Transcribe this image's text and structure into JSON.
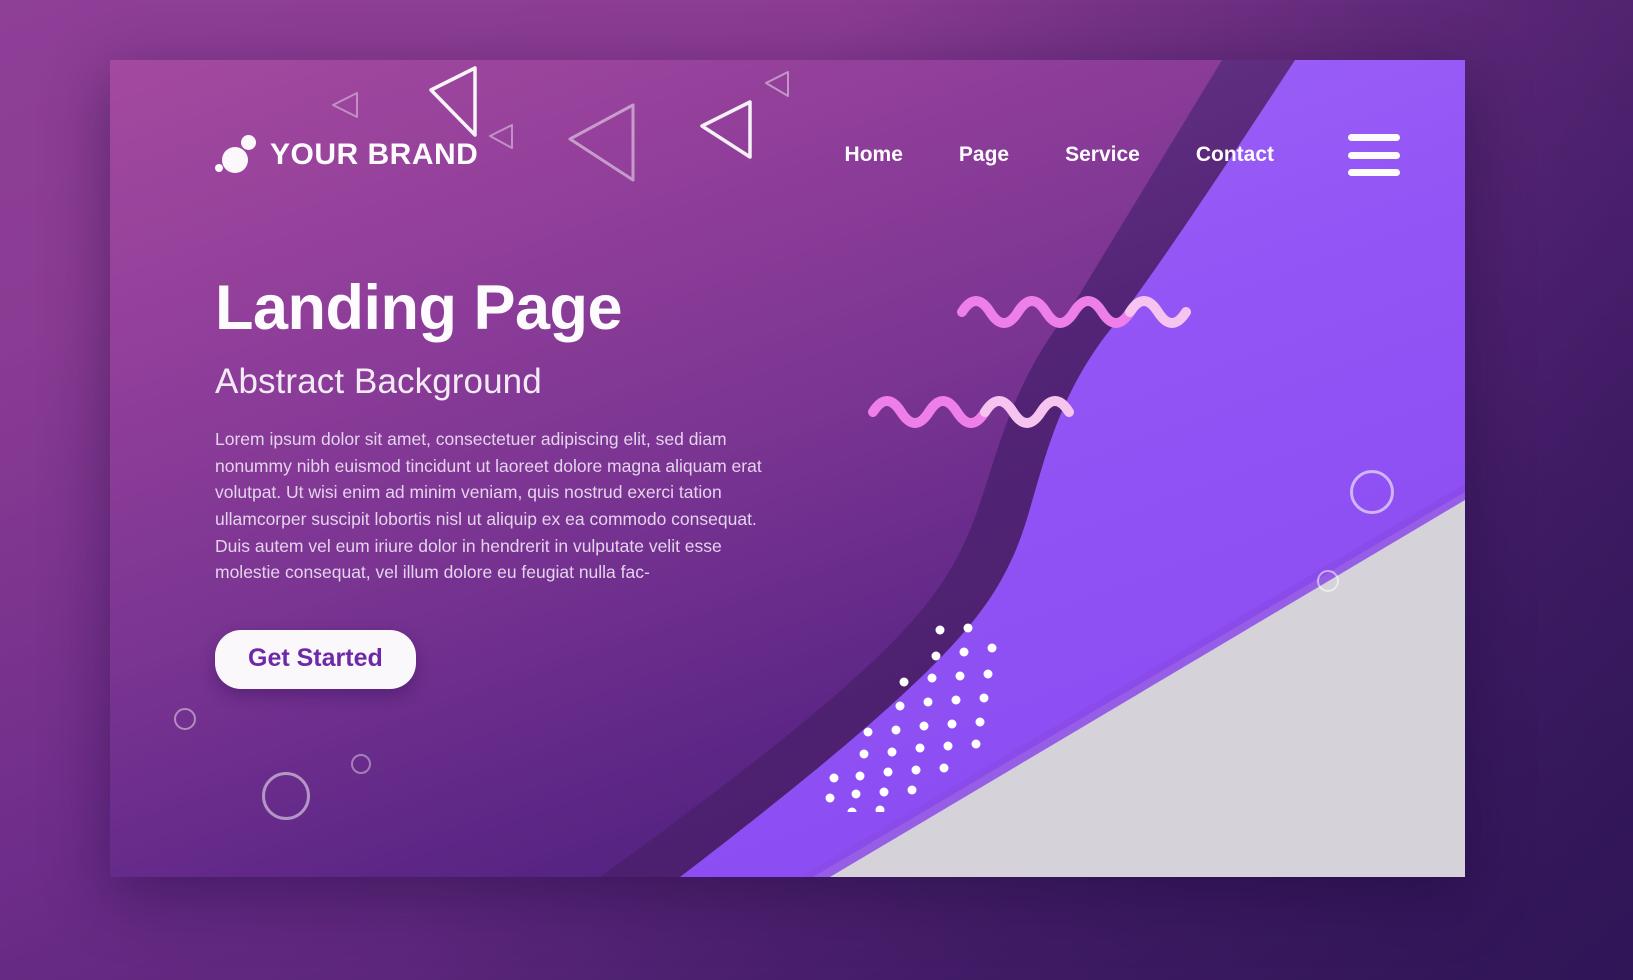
{
  "brand": {
    "name": "YOUR BRAND",
    "logo_icon": "three-circles-icon"
  },
  "nav": {
    "items": [
      {
        "label": "Home"
      },
      {
        "label": "Page"
      },
      {
        "label": "Service"
      },
      {
        "label": "Contact"
      }
    ],
    "menu_icon": "hamburger-menu-icon"
  },
  "hero": {
    "title": "Landing Page",
    "subtitle": "Abstract Background",
    "paragraph": "Lorem ipsum dolor sit amet, consectetuer adipiscing elit, sed diam nonummy nibh euismod tincidunt ut laoreet dolore magna aliquam erat volutpat. Ut wisi enim ad minim veniam, quis nostrud exerci tation ullamcorper suscipit lobortis nisl ut aliquip ex ea commodo consequat. Duis autem vel eum iriure dolor in hendrerit in vulputate velit esse molestie consequat, vel illum dolore eu feugiat nulla fac-",
    "cta_label": "Get Started"
  },
  "colors": {
    "frame_background": "#8c3c94",
    "frame_background_dark": "#3d1a63",
    "card_purple_light": "#a0499f",
    "card_purple_dark": "#4e2080",
    "bright_purple": "#9b5cf6",
    "shadow_purple": "#4a1f6e",
    "gray_triangle": "#d5d2da",
    "wave_pink": "#ef7fe8",
    "wave_pink_light": "#f5b8ee",
    "text_white": "#fdfbfe",
    "cta_text": "#6d29a8",
    "cta_background": "#fbf8fb"
  },
  "decor": {
    "triangles": [
      {
        "name": "triangle-outline-1",
        "size": 26,
        "opacity": 0.42
      },
      {
        "name": "triangle-outline-2",
        "size": 60,
        "opacity": 0.95
      },
      {
        "name": "triangle-outline-3",
        "size": 24,
        "opacity": 0.42
      },
      {
        "name": "triangle-outline-4",
        "size": 78,
        "opacity": 0.55
      },
      {
        "name": "triangle-outline-5",
        "size": 60,
        "opacity": 0.9
      },
      {
        "name": "triangle-outline-6",
        "size": 24,
        "opacity": 0.45
      }
    ],
    "rings": [
      {
        "name": "ring-small-left",
        "diameter": 22
      },
      {
        "name": "ring-large-left",
        "diameter": 48
      },
      {
        "name": "ring-tiny-left",
        "diameter": 18
      },
      {
        "name": "ring-large-right",
        "diameter": 44
      },
      {
        "name": "ring-small-right",
        "diameter": 22
      }
    ],
    "waves": [
      {
        "name": "wave-top"
      },
      {
        "name": "wave-bottom"
      }
    ],
    "dot_grid": {
      "name": "dot-grid-pattern",
      "rows": 11,
      "cols": 9
    }
  }
}
